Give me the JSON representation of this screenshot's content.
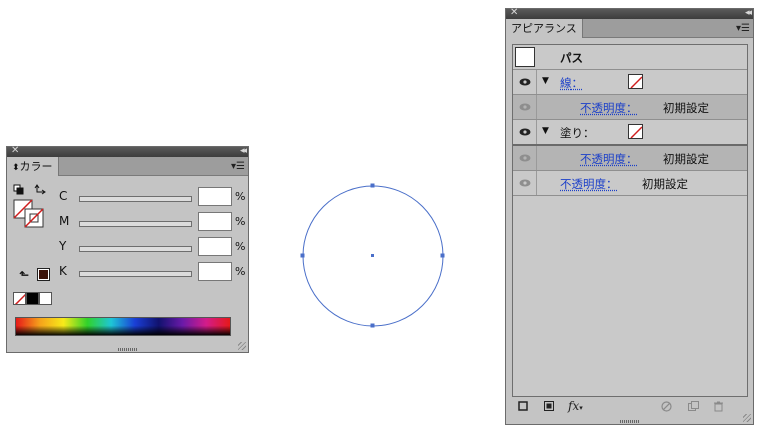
{
  "color_panel": {
    "close_icon": "close-icon",
    "collapse_icon": "collapse-icon",
    "tab_label": "カラー",
    "tab_arrow": "⬍",
    "sliders": [
      {
        "label": "C",
        "value": "",
        "unit": "%"
      },
      {
        "label": "M",
        "value": "",
        "unit": "%"
      },
      {
        "label": "Y",
        "value": "",
        "unit": "%"
      },
      {
        "label": "K",
        "value": "",
        "unit": "%"
      }
    ],
    "out_of_gamut_color": "#3b1208",
    "spectrum": "color-spectrum"
  },
  "artboard": {
    "shape": "circle",
    "stroke_color": "#4a6fc9"
  },
  "appearance_panel": {
    "tab_label": "アピアランス",
    "header_label": "パス",
    "rows": [
      {
        "kind": "stroke",
        "label": "線",
        "colon": "：",
        "swatch": "none"
      },
      {
        "kind": "opacity",
        "label": "不透明度",
        "colon": "：",
        "value": "初期設定"
      },
      {
        "kind": "fill",
        "label": "塗り",
        "colon": "：",
        "swatch": "none"
      },
      {
        "kind": "opacity",
        "label": "不透明度",
        "colon": "：",
        "value": "初期設定"
      },
      {
        "kind": "opacity",
        "label": "不透明度",
        "colon": "：",
        "value": "初期設定"
      }
    ],
    "footer": {
      "fx_label": "fx"
    }
  }
}
